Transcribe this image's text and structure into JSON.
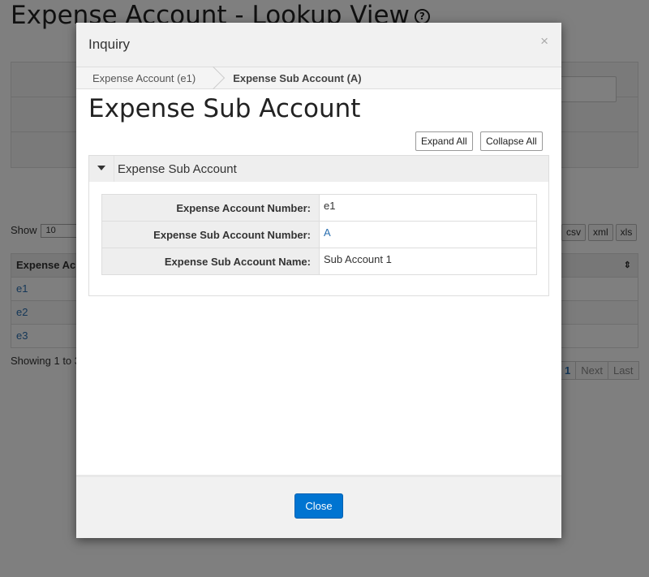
{
  "background": {
    "title": "Expense Account - Lookup View",
    "help_icon": "?",
    "show_label": "Show",
    "show_value": "10",
    "export_buttons": [
      "csv",
      "xml",
      "xls"
    ],
    "table_header": "Expense Ac",
    "rows": [
      "e1",
      "e2",
      "e3"
    ],
    "showing": "Showing 1 to 3",
    "pager": [
      "1",
      "Next",
      "Last"
    ]
  },
  "modal": {
    "title": "Inquiry",
    "close_x": "×",
    "breadcrumb": {
      "first": "Expense Account (e1)",
      "current": "Expense Sub Account (A)"
    },
    "heading": "Expense Sub Account",
    "expand_all": "Expand All",
    "collapse_all": "Collapse All",
    "section_title": "Expense Sub Account",
    "fields": [
      {
        "label": "Expense Account Number:",
        "value": "e1"
      },
      {
        "label": "Expense Sub Account Number:",
        "value": "A"
      },
      {
        "label": "Expense Sub Account Name:",
        "value": "Sub Account 1"
      }
    ],
    "close_button": "Close"
  },
  "colors": {
    "primary_button": "#0074d1",
    "link": "#2a6fb0"
  }
}
